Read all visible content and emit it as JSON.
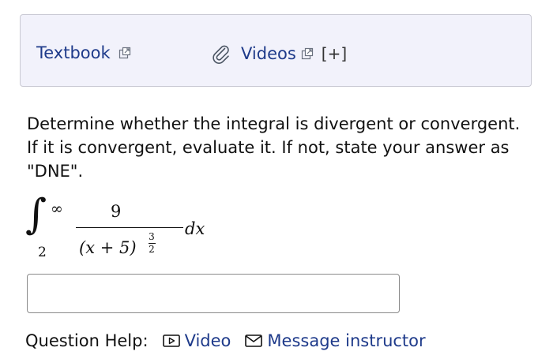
{
  "resources": {
    "textbook_label": "Textbook",
    "videos_label": "Videos",
    "expand_label": "[+]"
  },
  "question": {
    "text": "Determine whether the integral is divergent or convergent. If it is convergent, evaluate it. If not, state your answer as \"DNE\".",
    "integral": {
      "upper_limit": "∞",
      "lower_limit": "2",
      "numerator": "9",
      "denominator_base": "(x + 5)",
      "exponent_numerator": "3",
      "exponent_denominator": "2",
      "differential": "dx"
    }
  },
  "answer": {
    "value": ""
  },
  "help": {
    "label": "Question Help:",
    "video_label": "Video",
    "message_label": "Message instructor"
  },
  "colors": {
    "link": "#1e3a8a",
    "resource_bg": "#f2f2fb",
    "resource_border": "#c9c9d3"
  },
  "icons": {
    "external_link": "external-link-icon",
    "attachment": "paperclip-icon",
    "video": "play-box-icon",
    "message": "envelope-icon"
  }
}
